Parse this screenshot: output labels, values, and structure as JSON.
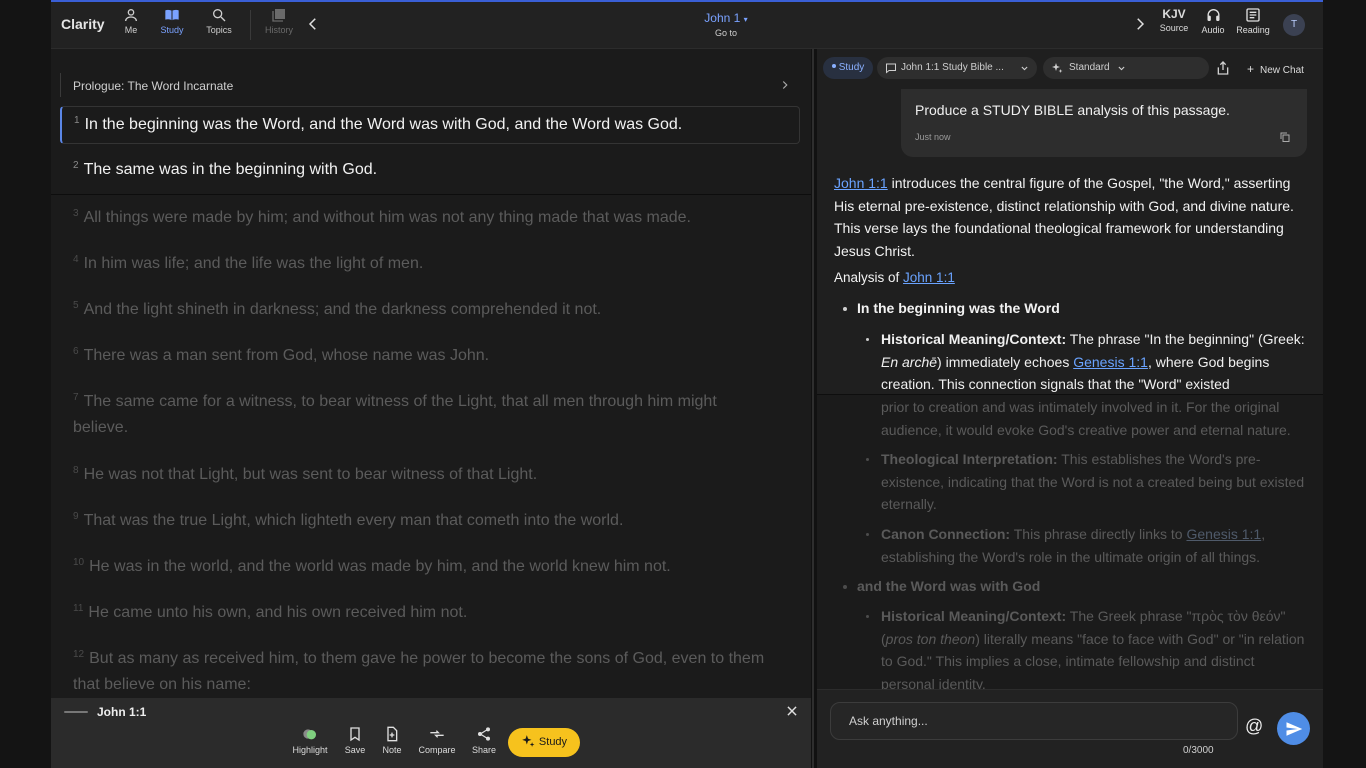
{
  "header": {
    "brand": "Clarity",
    "nav": [
      {
        "label": "Me",
        "icon": "person-icon"
      },
      {
        "label": "Study",
        "icon": "book-open-icon"
      },
      {
        "label": "Topics",
        "icon": "search-icon"
      },
      {
        "label": "History",
        "icon": "library-icon"
      }
    ],
    "passage": "John 1",
    "goto": "Go to",
    "source_value": "KJV",
    "source_label": "Source",
    "audio_label": "Audio",
    "reading_label": "Reading",
    "avatar": "T"
  },
  "reader": {
    "section_heading": "Prologue: The Word Incarnate",
    "verses": [
      {
        "num": "1",
        "text": "In the beginning was the Word, and the Word was with God, and the Word was God."
      },
      {
        "num": "2",
        "text": "The same was in the beginning with God."
      },
      {
        "num": "3",
        "text": "All things were made by him; and without him was not any thing made that was made."
      },
      {
        "num": "4",
        "text": "In him was life; and the life was the light of men."
      },
      {
        "num": "5",
        "text": "And the light shineth in darkness; and the darkness comprehended it not."
      },
      {
        "num": "6",
        "text": "There was a man sent from God, whose name was John."
      },
      {
        "num": "7",
        "text": "The same came for a witness, to bear witness of the Light, that all men through him might believe."
      },
      {
        "num": "8",
        "text": "He was not that Light, but was sent to bear witness of that Light."
      },
      {
        "num": "9",
        "text": "That was the true Light, which lighteth every man that cometh into the world."
      },
      {
        "num": "10",
        "text": "He was in the world, and the world was made by him, and the world knew him not."
      },
      {
        "num": "11",
        "text": "He came unto his own, and his own received him not."
      },
      {
        "num": "12",
        "text": "But as many as received him, to them gave he power to become the sons of God, even to them that believe on his name:"
      }
    ]
  },
  "toolbar": {
    "reference": "John 1:1",
    "highlight": "Highlight",
    "save": "Save",
    "note": "Note",
    "compare": "Compare",
    "share": "Share",
    "study": "Study"
  },
  "chat": {
    "mode_chip": "Study",
    "title_chip": "John 1:1 Study Bible ...",
    "style_chip": "Standard",
    "new_chat": "New Chat",
    "user_message": "Produce a STUDY BIBLE analysis of this passage.",
    "timestamp": "Just now",
    "intro_link": "John 1:1",
    "intro_text": " introduces the central figure of the Gospel, \"the Word,\" asserting His eternal pre-existence, distinct relationship with God, and divine nature. This verse lays the foundational theological framework for understanding Jesus Christ.",
    "analysis_prefix": "Analysis of ",
    "analysis_link": "John 1:1",
    "point1": "In the beginning was the Word",
    "hist_label": "Historical Meaning/Context:",
    "hist_text_a": " The phrase \"In the beginning\" (Greek: ",
    "hist_greek": "En archē",
    "hist_text_b": ") immediately echoes ",
    "hist_link": "Genesis 1:1",
    "hist_text_c": ", where God begins creation. This connection signals that the \"Word\" existed",
    "hist_text_d": "prior to creation and was intimately involved in it. For the original audience, it would evoke God's creative power and eternal nature.",
    "theo_label": "Theological Interpretation:",
    "theo_text": " This establishes the Word's pre-existence, indicating that the Word is not a created being but existed eternally.",
    "canon_label": "Canon Connection:",
    "canon_text_a": " This phrase directly links to ",
    "canon_link": "Genesis 1:1",
    "canon_text_b": ", establishing the Word's role in the ultimate origin of all things.",
    "point2": "and the Word was with God",
    "hist2_label": "Historical Meaning/Context:",
    "hist2_text_a": " The Greek phrase \"πρὸς τὸν θεόν\" (",
    "hist2_italic": "pros ton theon",
    "hist2_text_b": ") literally means \"face to face with God\" or \"in relation to God.\" This implies a close, intimate fellowship and distinct personal identity.",
    "input_placeholder": "Ask anything...",
    "at_symbol": "@",
    "counter": "0/3000"
  }
}
